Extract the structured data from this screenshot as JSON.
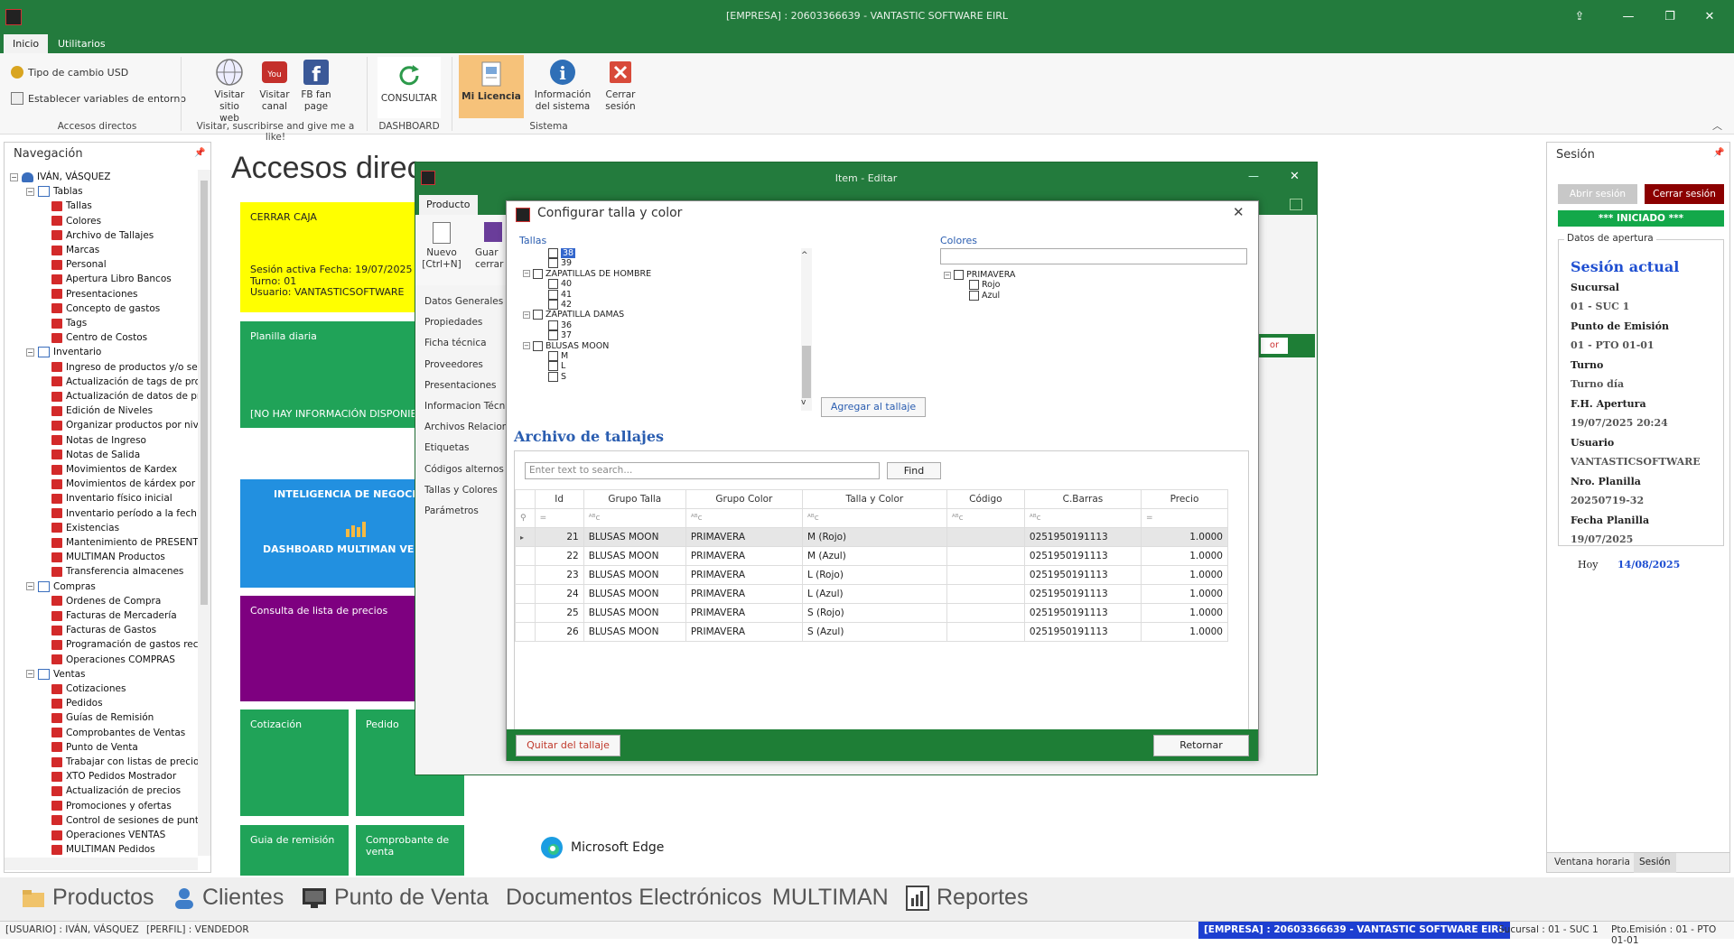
{
  "titlebar": {
    "title": "[EMPRESA] : 20603366639 - VANTASTIC SOFTWARE EIRL"
  },
  "ribbon": {
    "tabs": [
      "Inicio",
      "Utilitarios"
    ],
    "tipo_cambio": "Tipo de cambio USD",
    "establecer": "Establecer variables de entorno",
    "accesos_label": "Accesos directos",
    "visitar_web": "Visitar sitio web",
    "visitar_canal": "Visitar canal",
    "fb": "FB fan page",
    "visitar_group": "Visitar, suscribirse and give me a like!",
    "consultar": "CONSULTAR",
    "dashboard_group": "DASHBOARD",
    "licencia": "Mi Licencia",
    "info": "Información del sistema",
    "cerrar": "Cerrar sesión",
    "sistema_group": "Sistema"
  },
  "nav": {
    "header": "Navegación",
    "user": "IVÁN, VÁSQUEZ",
    "tablas": {
      "label": "Tablas",
      "items": [
        "Tallas",
        "Colores",
        "Archivo de Tallajes",
        "Marcas",
        "Personal",
        "Apertura Libro Bancos",
        "Presentaciones",
        "Concepto de gastos",
        "Tags",
        "Centro de Costos"
      ]
    },
    "inventario": {
      "label": "Inventario",
      "items": [
        "Ingreso de productos y/o se",
        "Actualización de tags de pro",
        "Actualización de datos de pr",
        "Edición de Niveles",
        "Organizar productos por niv",
        "Notas de Ingreso",
        "Notas de Salida",
        "Movimientos de Kardex",
        "Movimientos de kárdex por p",
        "Inventario físico inicial",
        "Inventario período a la fech",
        "Existencias",
        "Mantenimiento de PRESENTA",
        "MULTIMAN Productos",
        "Transferencia almacenes"
      ]
    },
    "compras": {
      "label": "Compras",
      "items": [
        "Ordenes de Compra",
        "Facturas de Mercadería",
        "Facturas de Gastos",
        "Programación de gastos rec",
        "Operaciones COMPRAS"
      ]
    },
    "ventas": {
      "label": "Ventas",
      "items": [
        "Cotizaciones",
        "Pedidos",
        "Guías de Remisión",
        "Comprobantes de Ventas",
        "Punto de Venta",
        "Trabajar con listas de precio",
        "XTO Pedidos Mostrador",
        "Actualización de precios",
        "Promociones y ofertas",
        "Control de sesiones de punt",
        "Operaciones VENTAS",
        "MULTIMAN Pedidos",
        "MULTIMAN Ventas"
      ]
    }
  },
  "center": {
    "title": "Accesos direc",
    "cerrar_caja": {
      "title": "CERRAR CAJA",
      "sesion": "Sesión activa Fecha: 19/07/2025 20:2",
      "turno": "Turno: 01",
      "usuario": "Usuario: VANTASTICSOFTWARE"
    },
    "planilla": {
      "title": "Planilla diaria",
      "info": "[NO HAY INFORMACIÓN DISPONIBLE"
    },
    "inteligencia": "INTELIGENCIA DE NEGOCI",
    "dashboard": "DASHBOARD MULTIMAN VE",
    "consulta": "Consulta de lista de precios",
    "cotizacion": "Cotización",
    "pedido": "Pedido",
    "guia": "Guia de remisión",
    "comprobante": "Comprobante de venta",
    "edge": "Microsoft Edge"
  },
  "itemwin": {
    "title": "Item  - Editar",
    "tab": "Producto",
    "nuevo": "Nuevo [Ctrl+N]",
    "guardar": "Guar cerrar",
    "side": [
      "Datos Generales",
      "Propiedades",
      "Ficha técnica",
      "Proveedores",
      "Presentaciones",
      "Informacion Técnic",
      "Archivos Relaciona",
      "Etiquetas",
      "Códigos alternos",
      "Tallas y Colores",
      "Parámetros"
    ],
    "btn_partial": "or"
  },
  "dialog": {
    "title": "Configurar talla y color",
    "tallas_label": "Tallas",
    "colores_label": "Colores",
    "tallas_tree": [
      {
        "t": "38",
        "lvl": 2,
        "sel": true
      },
      {
        "t": "39",
        "lvl": 2
      },
      {
        "t": "ZAPATILLAS DE HOMBRE",
        "lvl": 1
      },
      {
        "t": "40",
        "lvl": 2
      },
      {
        "t": "41",
        "lvl": 2
      },
      {
        "t": "42",
        "lvl": 2
      },
      {
        "t": "ZAPATILLA DAMAS",
        "lvl": 1
      },
      {
        "t": "36",
        "lvl": 2
      },
      {
        "t": "37",
        "lvl": 2
      },
      {
        "t": "BLUSAS MOON",
        "lvl": 1
      },
      {
        "t": "M",
        "lvl": 2
      },
      {
        "t": "L",
        "lvl": 2
      },
      {
        "t": "S",
        "lvl": 2
      }
    ],
    "colores_tree": [
      {
        "t": "PRIMAVERA",
        "lvl": 1
      },
      {
        "t": "Rojo",
        "lvl": 2
      },
      {
        "t": "Azul",
        "lvl": 2
      }
    ],
    "agregar": "Agregar al tallaje",
    "archivo_title": "Archivo de tallajes",
    "search_placeholder": "Enter text to search...",
    "find": "Find",
    "columns": [
      "Id",
      "Grupo Talla",
      "Grupo Color",
      "Talla y Color",
      "Código",
      "C.Barras",
      "Precio"
    ],
    "rows": [
      [
        "21",
        "BLUSAS MOON",
        "PRIMAVERA",
        "M (Rojo)",
        "",
        "0251950191113",
        "1.0000"
      ],
      [
        "22",
        "BLUSAS MOON",
        "PRIMAVERA",
        "M (Azul)",
        "",
        "0251950191113",
        "1.0000"
      ],
      [
        "23",
        "BLUSAS MOON",
        "PRIMAVERA",
        "L (Rojo)",
        "",
        "0251950191113",
        "1.0000"
      ],
      [
        "24",
        "BLUSAS MOON",
        "PRIMAVERA",
        "L (Azul)",
        "",
        "0251950191113",
        "1.0000"
      ],
      [
        "25",
        "BLUSAS MOON",
        "PRIMAVERA",
        "S (Rojo)",
        "",
        "0251950191113",
        "1.0000"
      ],
      [
        "26",
        "BLUSAS MOON",
        "PRIMAVERA",
        "S (Azul)",
        "",
        "0251950191113",
        "1.0000"
      ]
    ],
    "quitar": "Quitar del tallaje",
    "retornar": "Retornar"
  },
  "session": {
    "header": "Sesión",
    "abrir": "Abrir sesión",
    "cerrar": "Cerrar sesión",
    "iniciado": "*** INICIADO ***",
    "datos": "Datos de apertura",
    "actual": "Sesión actual",
    "fields": [
      [
        "Sucursal",
        "01 - SUC 1"
      ],
      [
        "Punto de Emisión",
        "01 - PTO 01-01"
      ],
      [
        "Turno",
        "Turno día"
      ],
      [
        "F.H. Apertura",
        "19/07/2025 20:24"
      ],
      [
        "Usuario",
        "VANTASTICSOFTWARE"
      ],
      [
        "Nro. Planilla",
        "20250719-32"
      ],
      [
        "Fecha Planilla",
        "19/07/2025"
      ]
    ],
    "hoy_label": "Hoy",
    "hoy_value": "14/08/2025",
    "tab_ventana": "Ventana horaria",
    "tab_sesion": "Sesión"
  },
  "bottom": {
    "productos": "Productos",
    "clientes": "Clientes",
    "pos": "Punto de Venta",
    "docs": "Documentos Electrónicos",
    "multiman": "MULTIMAN",
    "reportes": "Reportes"
  },
  "status": {
    "usuario": "[USUARIO] : IVÁN, VÁSQUEZ",
    "perfil": "[PERFIL] : VENDEDOR",
    "empresa": "[EMPRESA] : 20603366639 - VANTASTIC SOFTWARE EIRL",
    "sucursal": "Sucursal : 01 - SUC 1",
    "pto": "Pto.Emisión : 01 - PTO 01-01"
  }
}
